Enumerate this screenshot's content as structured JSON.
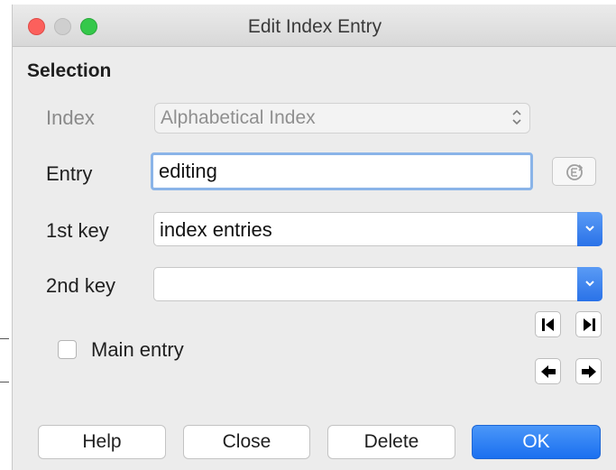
{
  "window": {
    "title": "Edit Index Entry"
  },
  "section": {
    "title": "Selection"
  },
  "fields": {
    "index": {
      "label": "Index",
      "value": "Alphabetical Index",
      "enabled": false
    },
    "entry": {
      "label": "Entry",
      "value": "editing"
    },
    "key1": {
      "label": "1st key",
      "value": "index entries"
    },
    "key2": {
      "label": "2nd key",
      "value": ""
    }
  },
  "main_entry": {
    "label": "Main entry",
    "checked": false
  },
  "navigation": {
    "icons": [
      "first-entry-icon",
      "last-entry-icon",
      "previous-entry-icon",
      "next-entry-icon"
    ]
  },
  "buttons": {
    "help": "Help",
    "close": "Close",
    "delete": "Delete",
    "ok": "OK"
  },
  "colors": {
    "accent": "#2a72e8",
    "close_light": "#fc605c",
    "zoom_light": "#34c84a"
  }
}
